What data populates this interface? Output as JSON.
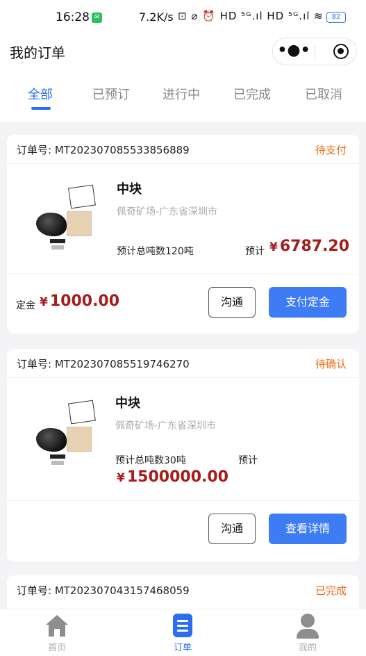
{
  "status_bar": {
    "time": "16:28",
    "network_speed": "7.2K/s",
    "indicators": "⊡ ⌀ ⏰ HD ⁵ᴳ.ıl HD ⁵ᴳ.ıl ≋",
    "battery": "82"
  },
  "header": {
    "title": "我的订单",
    "more_glyph": "•●•"
  },
  "tabs": [
    {
      "label": "全部",
      "active": true
    },
    {
      "label": "已预订",
      "active": false
    },
    {
      "label": "进行中",
      "active": false
    },
    {
      "label": "已完成",
      "active": false
    },
    {
      "label": "已取消",
      "active": false
    }
  ],
  "orders": [
    {
      "order_label": "订单号: MT202307085533856889",
      "status": "待支付",
      "product_name": "中块",
      "origin": "佩奇矿场-广东省深圳市",
      "tonnage": "预计总吨数120吨",
      "estimate_label": "预计",
      "currency": "¥",
      "estimate_price": "6787.20",
      "deposit_label": "定金",
      "deposit_price": "1000.00",
      "btn_contact": "沟通",
      "btn_action": "支付定金"
    },
    {
      "order_label": "订单号: MT202307085519746270",
      "status": "待确认",
      "product_name": "中块",
      "origin": "佩奇矿场-广东省深圳市",
      "tonnage": "预计总吨数30吨",
      "estimate_label": "预计",
      "currency": "¥",
      "estimate_price": "1500000.00",
      "btn_contact": "沟通",
      "btn_action": "查看详情"
    },
    {
      "order_label": "订单号: MT202307043157468059",
      "status": "已完成"
    }
  ],
  "bottom_nav": [
    {
      "label": "首页",
      "icon": "home-icon",
      "active": false
    },
    {
      "label": "订单",
      "icon": "orders-icon",
      "active": true
    },
    {
      "label": "我的",
      "icon": "profile-icon",
      "active": false
    }
  ],
  "colors": {
    "accent": "#2b6ef2",
    "status_orange": "#ee6a14",
    "price_red": "#a51c1c",
    "primary_button": "#3d7cf5"
  }
}
